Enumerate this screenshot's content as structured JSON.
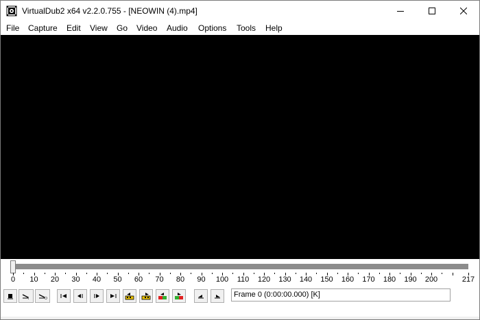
{
  "window": {
    "title": "VirtualDub2 x64 v2.2.0.755 - [NEOWIN (4).mp4]",
    "controls": [
      "minimize-icon",
      "maximize-icon",
      "close-icon"
    ]
  },
  "menu": {
    "items": [
      "File",
      "Capture",
      "Edit",
      "View",
      "Go",
      "Video",
      "Audio",
      "Options",
      "Tools",
      "Help"
    ]
  },
  "timeline": {
    "start": 0,
    "end": 217,
    "position": 0,
    "tick_labels": [
      "0",
      "10",
      "20",
      "30",
      "40",
      "50",
      "60",
      "70",
      "80",
      "90",
      "100",
      "110",
      "120",
      "130",
      "140",
      "150",
      "160",
      "170",
      "180",
      "190",
      "200",
      "217"
    ]
  },
  "toolbar": {
    "buttons": [
      {
        "icon": "stop-icon"
      },
      {
        "icon": "play-input-icon"
      },
      {
        "icon": "play-output-icon"
      },
      {
        "icon": "go-to-start-icon"
      },
      {
        "icon": "step-back-icon"
      },
      {
        "icon": "step-forward-icon"
      },
      {
        "icon": "go-to-end-icon"
      },
      {
        "icon": "previous-key-frame-icon"
      },
      {
        "icon": "next-key-frame-icon"
      },
      {
        "icon": "scene-back-icon"
      },
      {
        "icon": "scene-forward-icon"
      },
      {
        "icon": "mark-in-icon"
      },
      {
        "icon": "mark-out-icon"
      }
    ]
  },
  "status": {
    "frame_text": "Frame 0 (0:00:00.000) [K]"
  }
}
